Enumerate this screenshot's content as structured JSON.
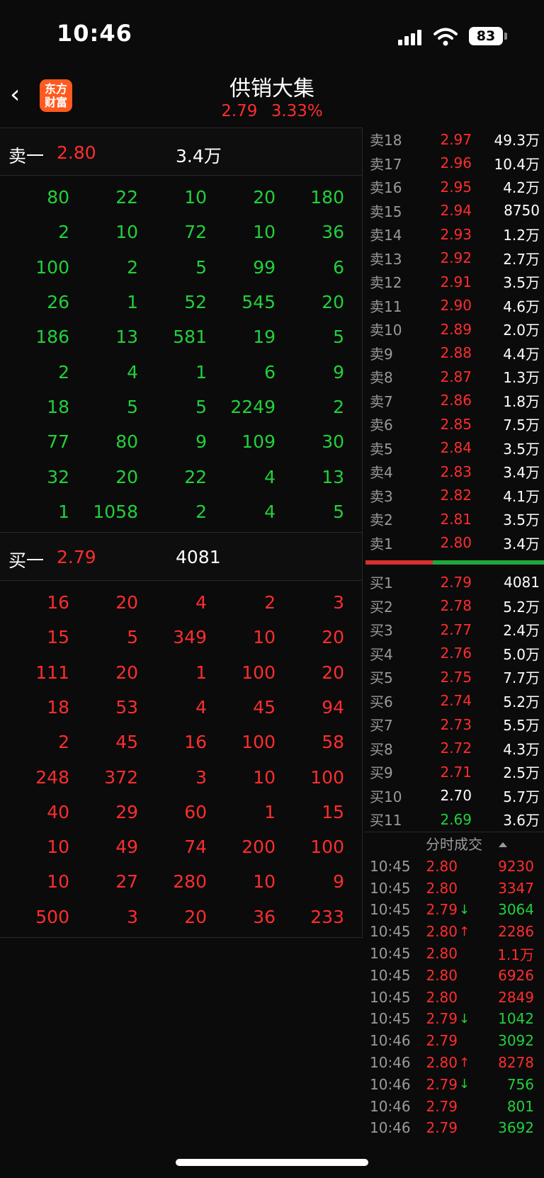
{
  "status": {
    "time": "10:46",
    "battery": "83"
  },
  "header": {
    "back": "‹",
    "logo": [
      "东方",
      "财富"
    ],
    "title": "供销大集",
    "price": "2.79",
    "change": "3.33%"
  },
  "ask1": {
    "label": "卖一",
    "price": "2.80",
    "volume": "3.4万"
  },
  "ask_orders": [
    [
      "80",
      "22",
      "10",
      "20",
      "180"
    ],
    [
      "2",
      "10",
      "72",
      "10",
      "36"
    ],
    [
      "100",
      "2",
      "5",
      "99",
      "6"
    ],
    [
      "26",
      "1",
      "52",
      "545",
      "20"
    ],
    [
      "186",
      "13",
      "581",
      "19",
      "5"
    ],
    [
      "2",
      "4",
      "1",
      "6",
      "9"
    ],
    [
      "18",
      "5",
      "5",
      "2249",
      "2"
    ],
    [
      "77",
      "80",
      "9",
      "109",
      "30"
    ],
    [
      "32",
      "20",
      "22",
      "4",
      "13"
    ],
    [
      "1",
      "1058",
      "2",
      "4",
      "5"
    ]
  ],
  "bid1": {
    "label": "买一",
    "price": "2.79",
    "volume": "4081"
  },
  "bid_orders": [
    [
      "16",
      "20",
      "4",
      "2",
      "3"
    ],
    [
      "15",
      "5",
      "349",
      "10",
      "20"
    ],
    [
      "111",
      "20",
      "1",
      "100",
      "20"
    ],
    [
      "18",
      "53",
      "4",
      "45",
      "94"
    ],
    [
      "2",
      "45",
      "16",
      "100",
      "58"
    ],
    [
      "248",
      "372",
      "3",
      "10",
      "100"
    ],
    [
      "40",
      "29",
      "60",
      "1",
      "15"
    ],
    [
      "10",
      "49",
      "74",
      "200",
      "100"
    ],
    [
      "10",
      "27",
      "280",
      "10",
      "9"
    ],
    [
      "500",
      "3",
      "20",
      "36",
      "233"
    ]
  ],
  "sell_levels": [
    {
      "label": "卖18",
      "price": "2.97",
      "volume": "49.3万",
      "color": "red"
    },
    {
      "label": "卖17",
      "price": "2.96",
      "volume": "10.4万",
      "color": "red"
    },
    {
      "label": "卖16",
      "price": "2.95",
      "volume": "4.2万",
      "color": "red"
    },
    {
      "label": "卖15",
      "price": "2.94",
      "volume": "8750",
      "color": "red"
    },
    {
      "label": "卖14",
      "price": "2.93",
      "volume": "1.2万",
      "color": "red"
    },
    {
      "label": "卖13",
      "price": "2.92",
      "volume": "2.7万",
      "color": "red"
    },
    {
      "label": "卖12",
      "price": "2.91",
      "volume": "3.5万",
      "color": "red"
    },
    {
      "label": "卖11",
      "price": "2.90",
      "volume": "4.6万",
      "color": "red"
    },
    {
      "label": "卖10",
      "price": "2.89",
      "volume": "2.0万",
      "color": "red"
    },
    {
      "label": "卖9",
      "price": "2.88",
      "volume": "4.4万",
      "color": "red"
    },
    {
      "label": "卖8",
      "price": "2.87",
      "volume": "1.3万",
      "color": "red"
    },
    {
      "label": "卖7",
      "price": "2.86",
      "volume": "1.8万",
      "color": "red"
    },
    {
      "label": "卖6",
      "price": "2.85",
      "volume": "7.5万",
      "color": "red"
    },
    {
      "label": "卖5",
      "price": "2.84",
      "volume": "3.5万",
      "color": "red"
    },
    {
      "label": "卖4",
      "price": "2.83",
      "volume": "3.4万",
      "color": "red"
    },
    {
      "label": "卖3",
      "price": "2.82",
      "volume": "4.1万",
      "color": "red"
    },
    {
      "label": "卖2",
      "price": "2.81",
      "volume": "3.5万",
      "color": "red"
    },
    {
      "label": "卖1",
      "price": "2.80",
      "volume": "3.4万",
      "color": "red"
    }
  ],
  "buy_levels": [
    {
      "label": "买1",
      "price": "2.79",
      "volume": "4081",
      "color": "red"
    },
    {
      "label": "买2",
      "price": "2.78",
      "volume": "5.2万",
      "color": "red"
    },
    {
      "label": "买3",
      "price": "2.77",
      "volume": "2.4万",
      "color": "red"
    },
    {
      "label": "买4",
      "price": "2.76",
      "volume": "5.0万",
      "color": "red"
    },
    {
      "label": "买5",
      "price": "2.75",
      "volume": "7.7万",
      "color": "red"
    },
    {
      "label": "买6",
      "price": "2.74",
      "volume": "5.2万",
      "color": "red"
    },
    {
      "label": "买7",
      "price": "2.73",
      "volume": "5.5万",
      "color": "red"
    },
    {
      "label": "买8",
      "price": "2.72",
      "volume": "4.3万",
      "color": "red"
    },
    {
      "label": "买9",
      "price": "2.71",
      "volume": "2.5万",
      "color": "red"
    },
    {
      "label": "买10",
      "price": "2.70",
      "volume": "5.7万",
      "color": "white"
    },
    {
      "label": "买11",
      "price": "2.69",
      "volume": "3.6万",
      "color": "green"
    }
  ],
  "trades_title": "分时成交",
  "trades": [
    {
      "time": "10:45",
      "price": "2.80",
      "arrow": "",
      "volume": "9230",
      "vcolor": "red"
    },
    {
      "time": "10:45",
      "price": "2.80",
      "arrow": "",
      "volume": "3347",
      "vcolor": "red"
    },
    {
      "time": "10:45",
      "price": "2.79",
      "arrow": "↓",
      "volume": "3064",
      "vcolor": "green"
    },
    {
      "time": "10:45",
      "price": "2.80",
      "arrow": "↑",
      "volume": "2286",
      "vcolor": "red"
    },
    {
      "time": "10:45",
      "price": "2.80",
      "arrow": "",
      "volume": "1.1万",
      "vcolor": "red"
    },
    {
      "time": "10:45",
      "price": "2.80",
      "arrow": "",
      "volume": "6926",
      "vcolor": "red"
    },
    {
      "time": "10:45",
      "price": "2.80",
      "arrow": "",
      "volume": "2849",
      "vcolor": "red"
    },
    {
      "time": "10:45",
      "price": "2.79",
      "arrow": "↓",
      "volume": "1042",
      "vcolor": "green"
    },
    {
      "time": "10:46",
      "price": "2.79",
      "arrow": "",
      "volume": "3092",
      "vcolor": "green"
    },
    {
      "time": "10:46",
      "price": "2.80",
      "arrow": "↑",
      "volume": "8278",
      "vcolor": "red"
    },
    {
      "time": "10:46",
      "price": "2.79",
      "arrow": "↓",
      "volume": "756",
      "vcolor": "green"
    },
    {
      "time": "10:46",
      "price": "2.79",
      "arrow": "",
      "volume": "801",
      "vcolor": "green"
    },
    {
      "time": "10:46",
      "price": "2.79",
      "arrow": "",
      "volume": "3692",
      "vcolor": "green"
    }
  ]
}
